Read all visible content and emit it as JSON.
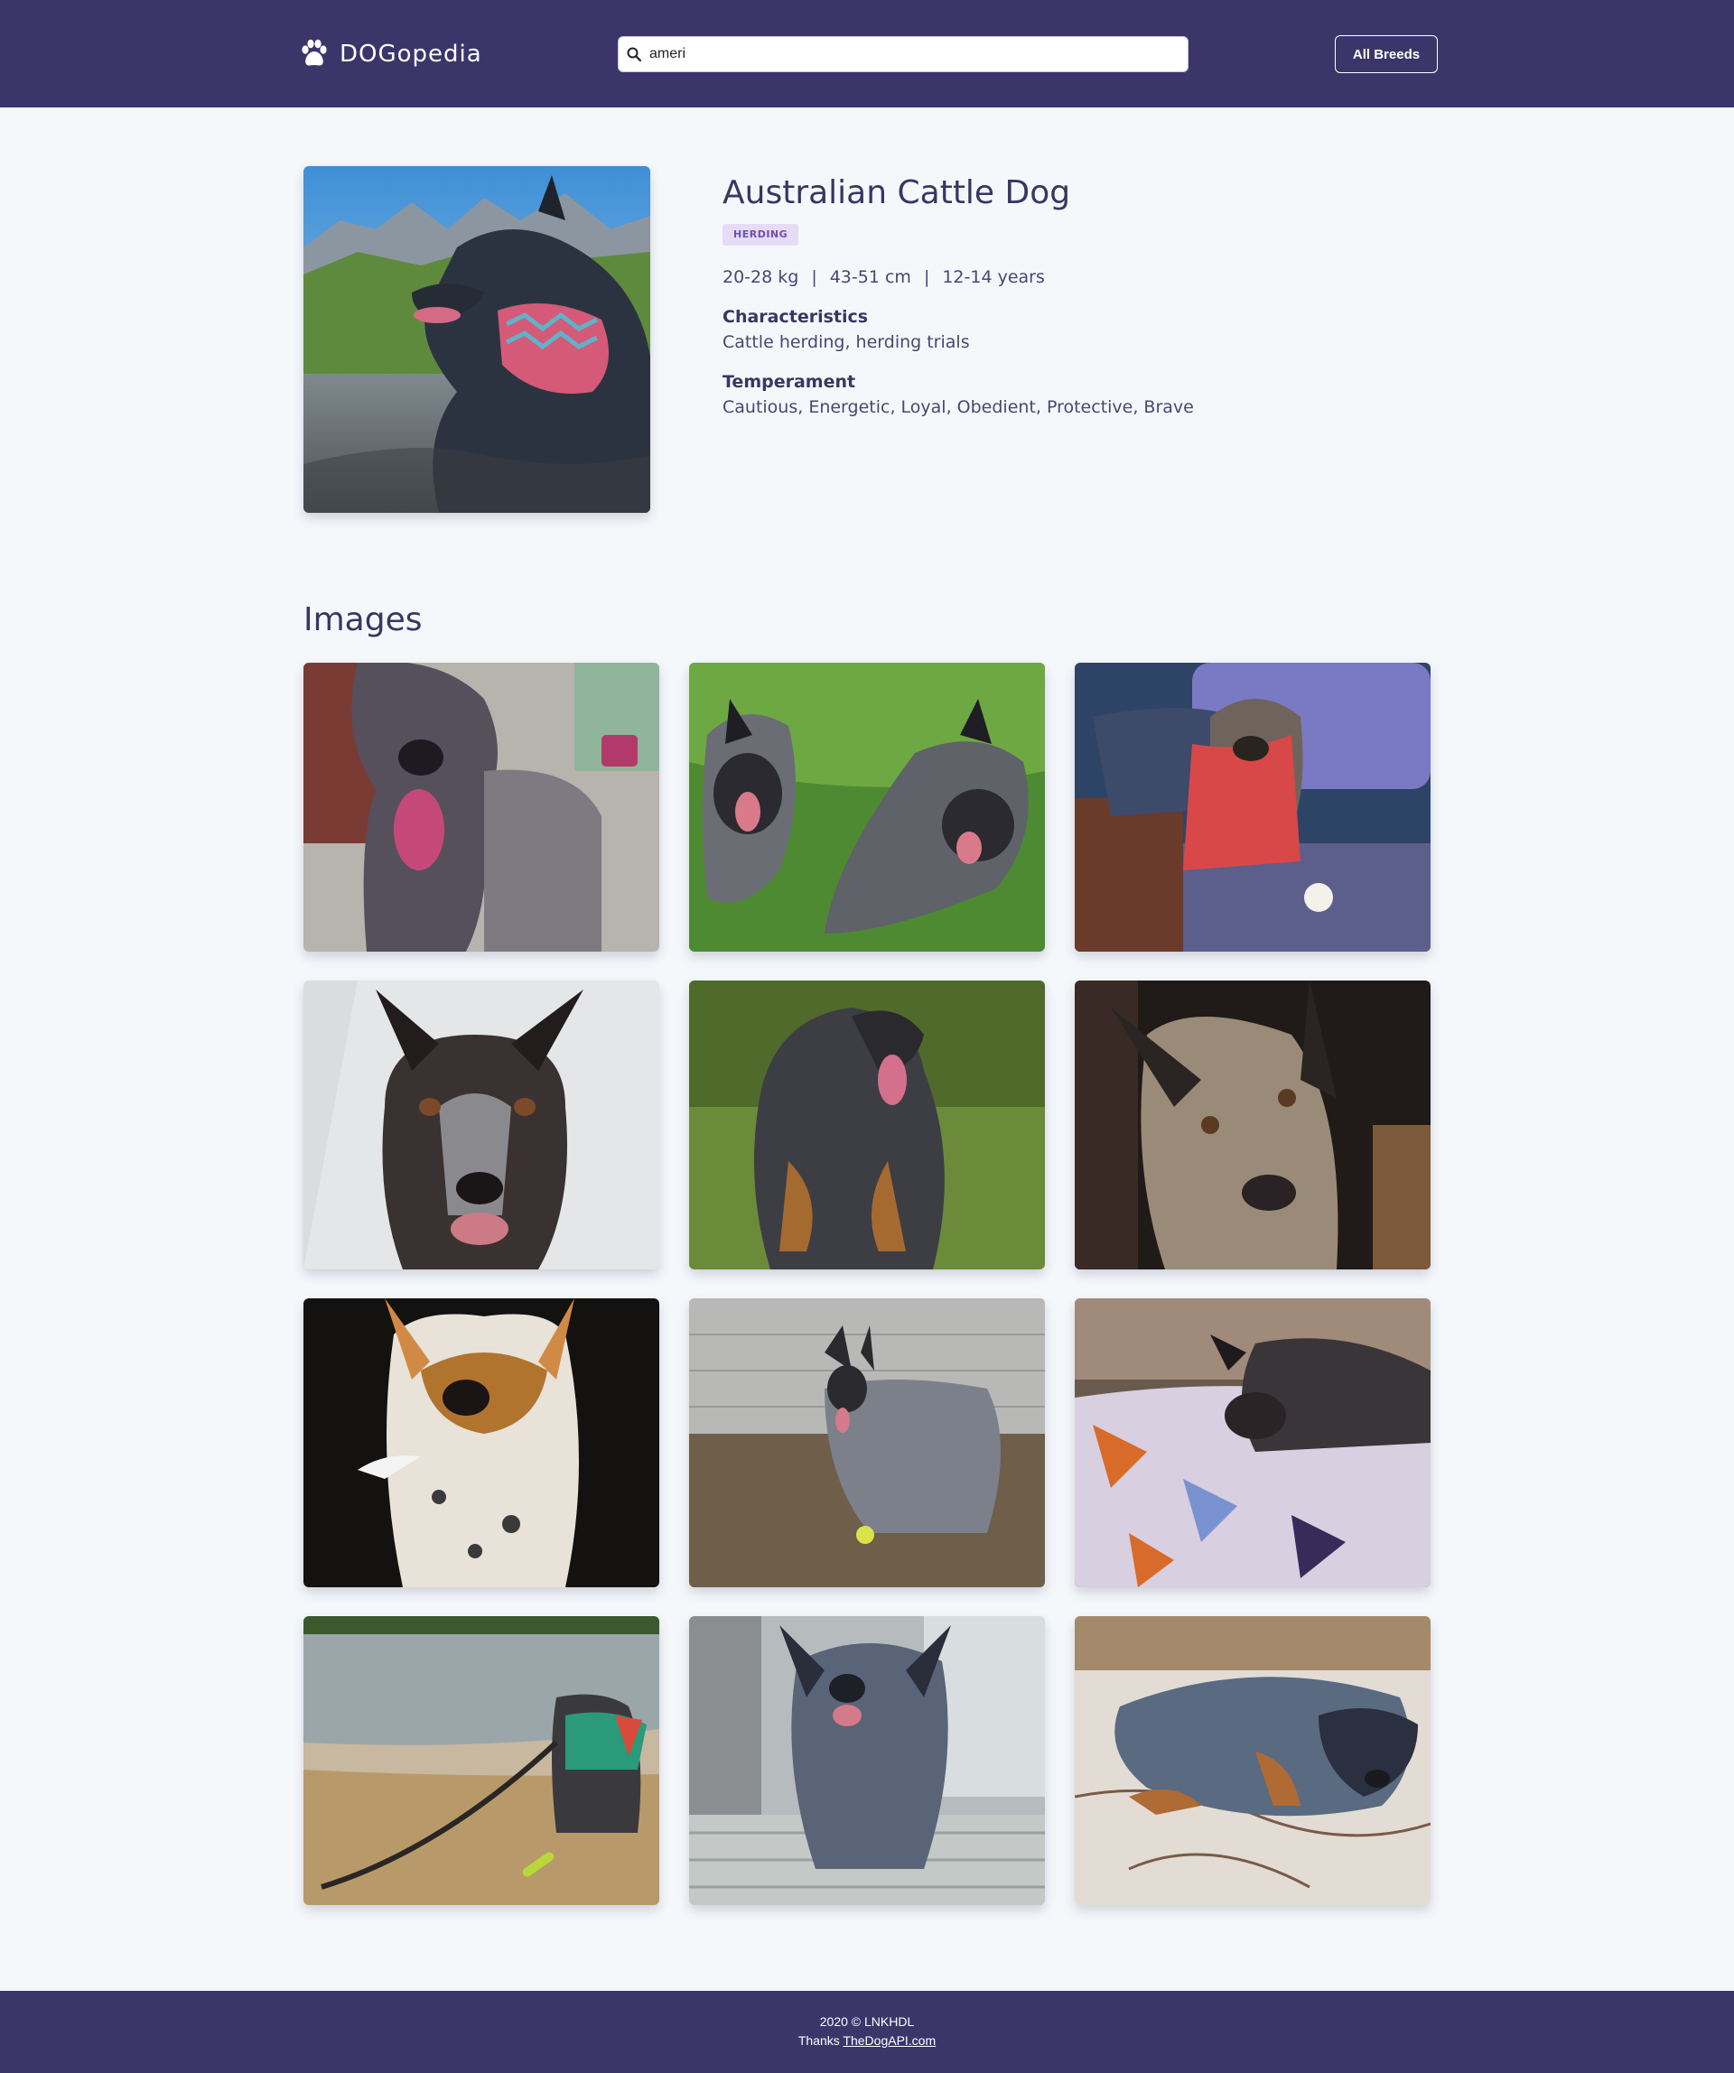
{
  "header": {
    "logo_text": "DOGopedia",
    "logo_icon": "paw-icon",
    "search": {
      "value": "ameri",
      "icon": "search-icon"
    },
    "all_breeds_label": "All Breeds"
  },
  "breed": {
    "name": "Australian Cattle Dog",
    "group": "HERDING",
    "weight": "20-28 kg",
    "height": "43-51 cm",
    "life_span": "12-14 years",
    "separator": "|",
    "characteristics_title": "Characteristics",
    "characteristics": "Cattle herding, herding trials",
    "temperament_title": "Temperament",
    "temperament": "Cautious, Energetic, Loyal, Obedient, Protective, Brave"
  },
  "gallery": {
    "heading": "Images",
    "count": 12
  },
  "footer": {
    "copyright": "2020 © LNKHDL",
    "thanks_prefix": "Thanks",
    "thanks_link": "TheDogAPI.com"
  },
  "colors": {
    "header_bg": "#3c356a",
    "page_bg": "#f5f8fb",
    "heading_text": "#3b3561",
    "badge_bg": "#e6dcf6",
    "badge_text": "#6c4fb0"
  }
}
